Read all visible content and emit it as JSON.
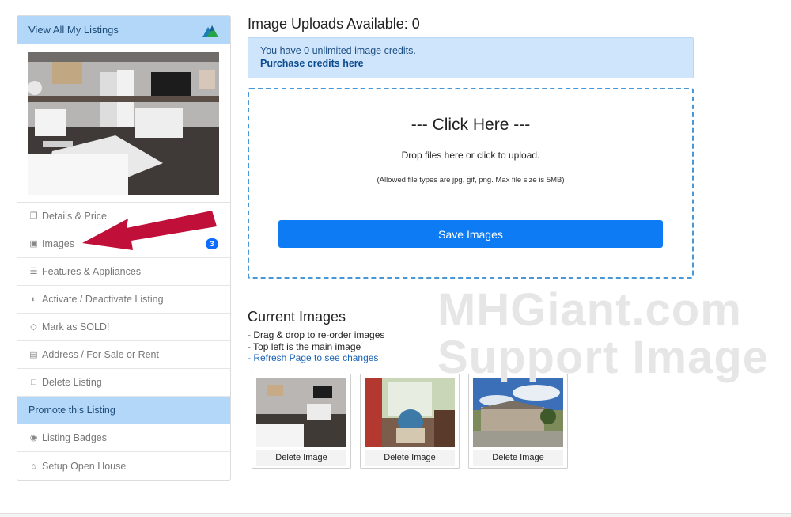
{
  "sidebar": {
    "header": "View All My Listings",
    "items": [
      {
        "label": "Details & Price",
        "icon": "copy-icon"
      },
      {
        "label": "Images",
        "icon": "image-icon",
        "badge": "3"
      },
      {
        "label": "Features & Appliances",
        "icon": "list-icon"
      },
      {
        "label": "Activate / Deactivate Listing",
        "icon": "toggle-icon"
      },
      {
        "label": "Mark as SOLD!",
        "icon": "diamond-icon"
      },
      {
        "label": "Address / For Sale or Rent",
        "icon": "map-icon"
      },
      {
        "label": "Delete Listing",
        "icon": "trash-icon"
      }
    ],
    "promote_header": "Promote this Listing",
    "promote_items": [
      {
        "label": "Listing Badges",
        "icon": "certificate-icon"
      },
      {
        "label": "Setup Open House",
        "icon": "home-icon"
      }
    ]
  },
  "main": {
    "uploads_title": "Image Uploads Available: 0",
    "credits_text": "You have 0 unlimited image credits.",
    "credits_link": "Purchase credits here",
    "dropzone": {
      "title": "--- Click Here ---",
      "subtitle": "Drop files here or click to upload.",
      "note": "(Allowed file types are jpg, gif, png. Max file size is 5MB)"
    },
    "save_button": "Save Images",
    "current_title": "Current Images",
    "notes": [
      "- Drag & drop to re-order images",
      "- Top left is the main image"
    ],
    "refresh_link": "- Refresh Page to see changes",
    "thumbnails": [
      {
        "delete_label": "Delete Image"
      },
      {
        "delete_label": "Delete Image"
      },
      {
        "delete_label": "Delete Image"
      }
    ]
  },
  "watermark": {
    "line1": "MHGiant.com",
    "line2": "Support Image"
  },
  "colors": {
    "accent": "#0d7bf4",
    "header_bg": "#b3d7f8",
    "arrow": "#c0103a"
  }
}
